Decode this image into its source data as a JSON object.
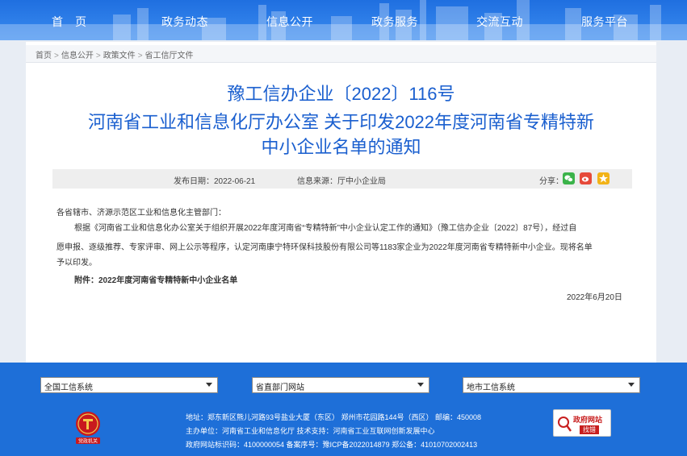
{
  "nav": {
    "items": [
      "首　页",
      "政务动态",
      "信息公开",
      "政务服务",
      "交流互动",
      "服务平台"
    ]
  },
  "breadcrumb": {
    "items": [
      "首页",
      "信息公开",
      "政策文件",
      "省工信厅文件"
    ],
    "separator": ">"
  },
  "article": {
    "title_line1": "豫工信办企业〔2022〕116号",
    "title_line2": "河南省工业和信息化厅办公室 关于印发2022年度河南省专精特新",
    "title_line3": "中小企业名单的通知",
    "publish_date": "发布日期：2022-06-21",
    "source": "信息来源：厅中小企业局",
    "share_label": "分享：",
    "salutation": "各省辖市、济源示范区工业和信息化主管部门：",
    "para_line1": "根据《河南省工业和信息化办公室关于组织开展2022年度河南省“专精特新”中小企业认定工作的通知》（豫工信办企业〔2022〕87号），经过自",
    "para_line2": "愿申报、逐级推荐、专家评审、网上公示等程序，认定河南康宁特环保科技股份有限公司等1183家企业为2022年度河南省专精特新中小企业。现将名单",
    "para_line3": "予以印发。",
    "attachment": "附件：2022年度河南省专精特新中小企业名单",
    "sign_date": "2022年6月20日"
  },
  "footer": {
    "select1": "全国工信系统",
    "select2": "省直部门网站",
    "select3": "地市工信系统",
    "address": "地址：郑东新区熊儿河路93号盐业大厦（东区）  郑州市花园路144号（西区）  邮编：450008",
    "sponsor": "主办单位：河南省工业和信息化厅  技术支持：河南省工业互联网创新发展中心",
    "ids": "政府网站标识码：4100000054  备案序号：豫ICP备2022014879  郑公备：41010702002413",
    "emblem_caption": "党政机关",
    "badge_title": "政府网站",
    "badge_action": "找错"
  },
  "colors": {
    "nav_blue": "#1f6fe0",
    "title_blue": "#1a5fcf",
    "footer_blue": "#1e6fd8",
    "badge_red": "#c81e1e"
  },
  "icons": [
    "wechat-icon",
    "weibo-icon",
    "star-icon",
    "party-emblem-icon",
    "gov-website-icon"
  ]
}
